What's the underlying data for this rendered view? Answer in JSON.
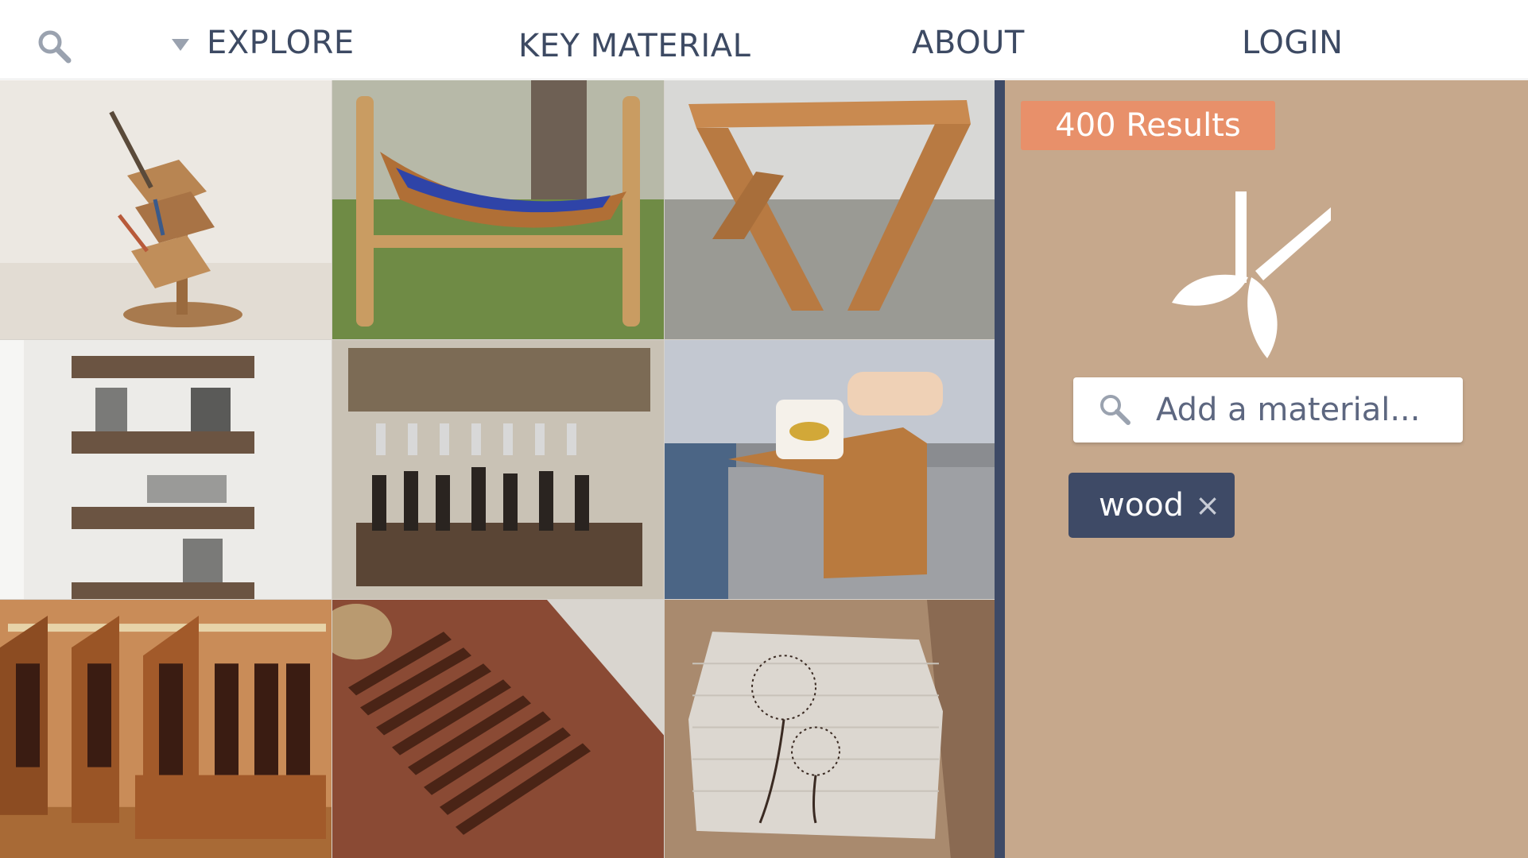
{
  "nav": {
    "search_icon": "search-icon",
    "explore": "EXPLORE",
    "key_material": "KEY MATERIAL",
    "about": "ABOUT",
    "login": "LOGIN"
  },
  "gallery": {
    "tiles": [
      "desk-organizer",
      "boat-cradle",
      "x-leg-stool",
      "floating-shelves",
      "pallet-wine-rack",
      "sofa-arm-tray",
      "beer-caddies",
      "slat-doormat",
      "dandelion-wall-art"
    ]
  },
  "panel": {
    "results": "400 Results",
    "logo_icon": "leaf-scissors-logo",
    "material_placeholder": "Add a material...",
    "tag_label": "wood",
    "tag_remove": "×"
  },
  "colors": {
    "nav_text": "#3d4a63",
    "panel_bg": "#c6a88c",
    "results_badge": "#e8906a",
    "tag_bg": "#3e4a66",
    "divider": "#3e4a66"
  }
}
